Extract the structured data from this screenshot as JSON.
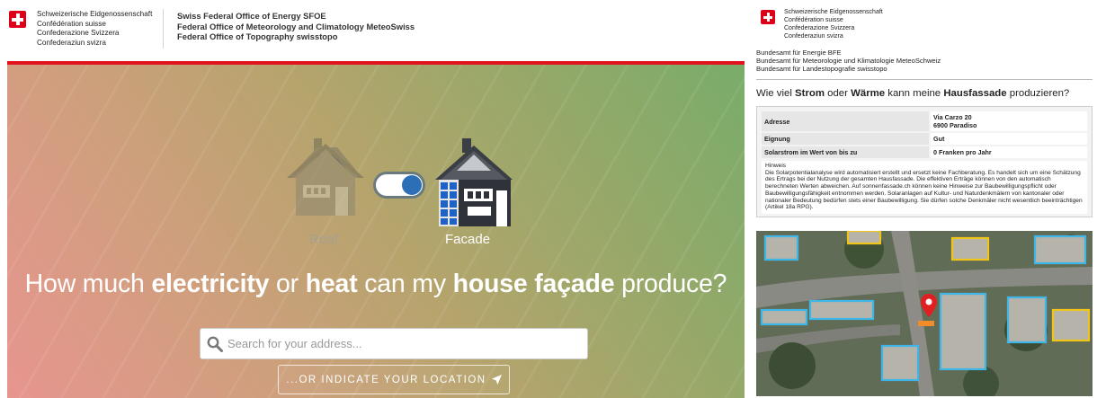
{
  "left": {
    "header": {
      "langs": [
        "Schweizerische Eidgenossenschaft",
        "Confédération suisse",
        "Confederazione Svizzera",
        "Confederaziun svizra"
      ],
      "offices": [
        "Swiss Federal Office of Energy SFOE",
        "Federal Office of Meteorology and Climatology MeteoSwiss",
        "Federal Office of Topography swisstopo"
      ]
    },
    "toggle": {
      "roof_label": "Roof",
      "facade_label": "Facade",
      "selected": "Facade"
    },
    "headline": {
      "p1": "How much ",
      "b1": "electricity",
      "p2": " or ",
      "b2": "heat",
      "p3": " can my ",
      "b3": "house façade",
      "p4": " produce?"
    },
    "search": {
      "placeholder": "Search for your address...",
      "value": ""
    },
    "location_button": "...OR INDICATE YOUR LOCATION",
    "colors": {
      "accent_red": "#e1141d",
      "toggle_blue": "#2d6fb6"
    }
  },
  "right": {
    "header": {
      "langs": [
        "Schweizerische Eidgenossenschaft",
        "Confédération suisse",
        "Confederazione Svizzera",
        "Confederaziun svizra"
      ],
      "offices": [
        "Bundesamt für Energie BFE",
        "Bundesamt für Meteorologie und Klimatologie MeteoSchweiz",
        "Bundesamt für Landestopografie swisstopo"
      ]
    },
    "title": {
      "p1": "Wie viel ",
      "b1": "Strom",
      "p2": " oder ",
      "b2": "Wärme",
      "p3": " kann meine ",
      "b3": "Hausfassade",
      "p4": " produzieren?"
    },
    "table": {
      "rows": [
        {
          "key": "Adresse",
          "value_lines": [
            "Via Carzo 20",
            "6900 Paradiso"
          ]
        },
        {
          "key": "Eignung",
          "value_lines": [
            "Gut"
          ]
        },
        {
          "key": "Solarstrom im Wert von bis zu",
          "value_lines": [
            "0 Franken pro Jahr"
          ]
        }
      ]
    },
    "note": {
      "title": "Hinweis",
      "text": "Die Solarpotentialanalyse wird automatisiert erstellt und ersetzt keine Fachberatung. Es handelt sich um eine Schätzung des Ertrags bei der Nutzung der gesamten Hausfassade. Die effektiven Erträge können von den automatisch berechneten Werten abweichen. Auf sonnenfassade.ch können keine Hinweise zur Baubewilligungspflicht oder Baubewilligungsfähigkeit entnommen werden. Solaranlagen auf Kultur- und Naturdenkmälern von kantonaler oder nationaler Bedeutung bedürfen stets einer Baubewilligung. Sie dürfen solche Denkmäler nicht wesentlich beeinträchtigen (Artikel 18a RPG)."
    },
    "map": {
      "marker_icon": "map-marker-icon",
      "facade_colors": [
        "#3fb6e8",
        "#f0c419",
        "#f28c28"
      ]
    }
  }
}
